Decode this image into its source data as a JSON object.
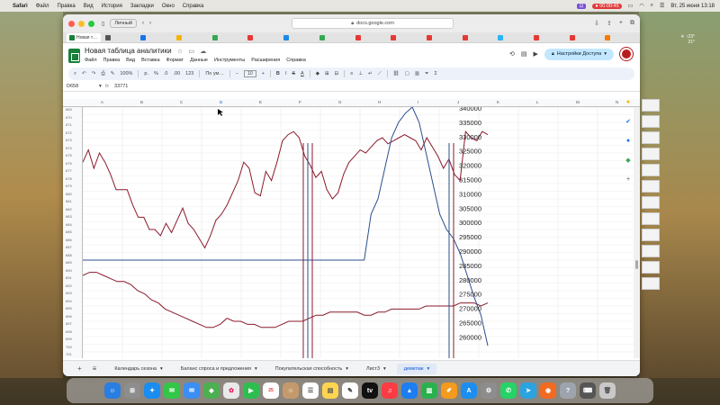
{
  "menubar": {
    "app": "Safari",
    "items": [
      "Файл",
      "Правка",
      "Вид",
      "История",
      "Закладки",
      "Окно",
      "Справка"
    ],
    "recording_time": "00:00:45",
    "datetime": "Вт, 25 июня 13:18"
  },
  "browser": {
    "profile": "Личный",
    "url": "docs.google.com",
    "tab_label": "Новая т…"
  },
  "sheet": {
    "title": "Новая таблица аналитики",
    "menus": [
      "Файл",
      "Правка",
      "Вид",
      "Вставка",
      "Формат",
      "Данные",
      "Инструменты",
      "Расширения",
      "Справка"
    ],
    "share_label": "Настройки Доступа",
    "toolbar": {
      "zoom": "100%",
      "currency": "р.",
      "percent": "%",
      "decimals": ".0",
      "decimals2": ".00",
      "format123": "123",
      "font": "По ум…",
      "font_size": "10",
      "bold": "B",
      "italic": "I",
      "strike": "S",
      "text_color": "A"
    },
    "namebox": "D658",
    "formula_value": "33771",
    "columns": [
      "A",
      "B",
      "C",
      "D",
      "E",
      "F",
      "G",
      "H",
      "I",
      "J",
      "K",
      "L",
      "M",
      "N"
    ],
    "rows": [
      "669",
      "670",
      "671",
      "672",
      "673",
      "674",
      "675",
      "676",
      "677",
      "678",
      "679",
      "680",
      "681",
      "682",
      "683",
      "684",
      "685",
      "686",
      "687",
      "688",
      "689",
      "690",
      "691",
      "692",
      "693",
      "694",
      "695",
      "696",
      "697",
      "698",
      "699",
      "700",
      "701"
    ],
    "sheet_tabs": [
      "Календарь сезона",
      "Баланс спроса и предложения",
      "Покупательская способность",
      "Лист3",
      "демктаж"
    ],
    "active_tab": "демктаж"
  },
  "chart_data": {
    "type": "line",
    "y_axis_labels": [
      "340000",
      "335000",
      "330000",
      "325000",
      "320000",
      "315000",
      "310000",
      "305000",
      "300000",
      "295000",
      "290000",
      "285000",
      "280000",
      "275000",
      "270000",
      "265000",
      "260000"
    ],
    "ylim": [
      260000,
      340000
    ],
    "series": [
      {
        "color": "#8b1a2b",
        "values": [
          322,
          326,
          320,
          325,
          322,
          318,
          313,
          313,
          313,
          308,
          304,
          304,
          300,
          300,
          298,
          302,
          299,
          303,
          307,
          302,
          300,
          297,
          294,
          298,
          303,
          305,
          308,
          312,
          316,
          322,
          320,
          312,
          311,
          319,
          316,
          322,
          329,
          331,
          332,
          330,
          324,
          321,
          317,
          319,
          313,
          310,
          312,
          318,
          322,
          324,
          326,
          325,
          327,
          329,
          330,
          328,
          329,
          330,
          331,
          330,
          329,
          326,
          330,
          327,
          324,
          320,
          323,
          318,
          316,
          332,
          330,
          329,
          332,
          331
        ]
      },
      {
        "color": "#8b1a2b",
        "values": [
          285,
          286,
          286,
          285,
          284,
          283,
          283,
          282,
          280,
          279,
          277,
          276,
          274,
          273,
          272,
          271,
          270,
          269,
          268,
          268,
          269,
          271,
          270,
          270,
          269,
          269,
          268,
          268,
          268,
          269,
          270,
          270,
          270,
          271,
          272,
          272,
          273,
          273,
          273,
          273,
          273,
          272,
          272,
          273,
          273,
          274,
          274,
          274,
          274,
          274,
          275,
          275,
          275,
          275,
          275,
          276,
          276,
          276,
          275,
          276
        ]
      },
      {
        "color": "#2b4f8f",
        "values": [
          290,
          290,
          290,
          290,
          290,
          290,
          290,
          290,
          290,
          290,
          290,
          290,
          290,
          290,
          290,
          290,
          290,
          290,
          290,
          290,
          290,
          290,
          290,
          290,
          290,
          290,
          290,
          290,
          290,
          290,
          290,
          290,
          290,
          290,
          290,
          290,
          290,
          290,
          290,
          290,
          290,
          290,
          305,
          310,
          320,
          330,
          335,
          338,
          340,
          335,
          325,
          315,
          305,
          300,
          297,
          292,
          285,
          278,
          272,
          262
        ]
      }
    ]
  }
}
